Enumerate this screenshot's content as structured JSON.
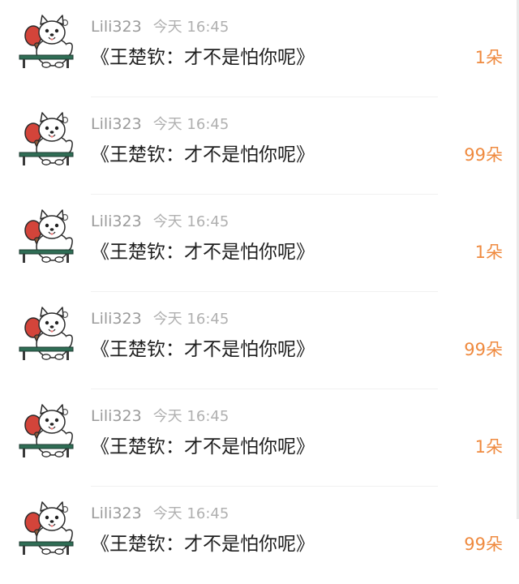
{
  "accent_color": "#ef8a3f",
  "avatar_icon": "samoyed-table-tennis-icon",
  "messages": [
    {
      "username": "Lili323",
      "time": "今天 16:45",
      "title": "《王楚钦：才不是怕你呢》",
      "gift": "1朵"
    },
    {
      "username": "Lili323",
      "time": "今天 16:45",
      "title": "《王楚钦：才不是怕你呢》",
      "gift": "99朵"
    },
    {
      "username": "Lili323",
      "time": "今天 16:45",
      "title": "《王楚钦：才不是怕你呢》",
      "gift": "1朵"
    },
    {
      "username": "Lili323",
      "time": "今天 16:45",
      "title": "《王楚钦：才不是怕你呢》",
      "gift": "99朵"
    },
    {
      "username": "Lili323",
      "time": "今天 16:45",
      "title": "《王楚钦：才不是怕你呢》",
      "gift": "1朵"
    },
    {
      "username": "Lili323",
      "time": "今天 16:45",
      "title": "《王楚钦：才不是怕你呢》",
      "gift": "99朵"
    }
  ]
}
